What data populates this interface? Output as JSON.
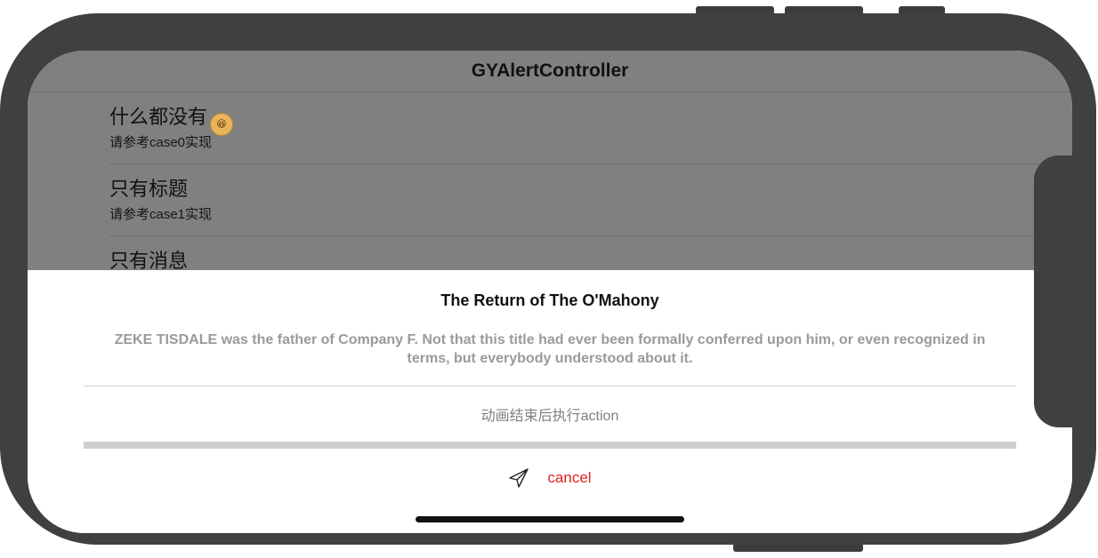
{
  "nav": {
    "title": "GYAlertController"
  },
  "list": {
    "rows": [
      {
        "title": "什么都没有",
        "subtitle": "请参考case0实现",
        "emoji": "😆"
      },
      {
        "title": "只有标题",
        "subtitle": "请参考case1实现"
      },
      {
        "title": "只有消息"
      }
    ]
  },
  "alert": {
    "title": "The Return of The O'Mahony",
    "message": "ZEKE TISDALE was the father of Company F. Not that this title had ever been formally conferred upon him, or even recognized in terms, but everybody understood about it.",
    "action_label": "动画结束后执行action",
    "cancel_label": "cancel",
    "cancel_icon": "paper-plane-icon"
  },
  "colors": {
    "dim_overlay": "#808080",
    "cancel_red": "#e02020",
    "device_frame": "#404040"
  }
}
